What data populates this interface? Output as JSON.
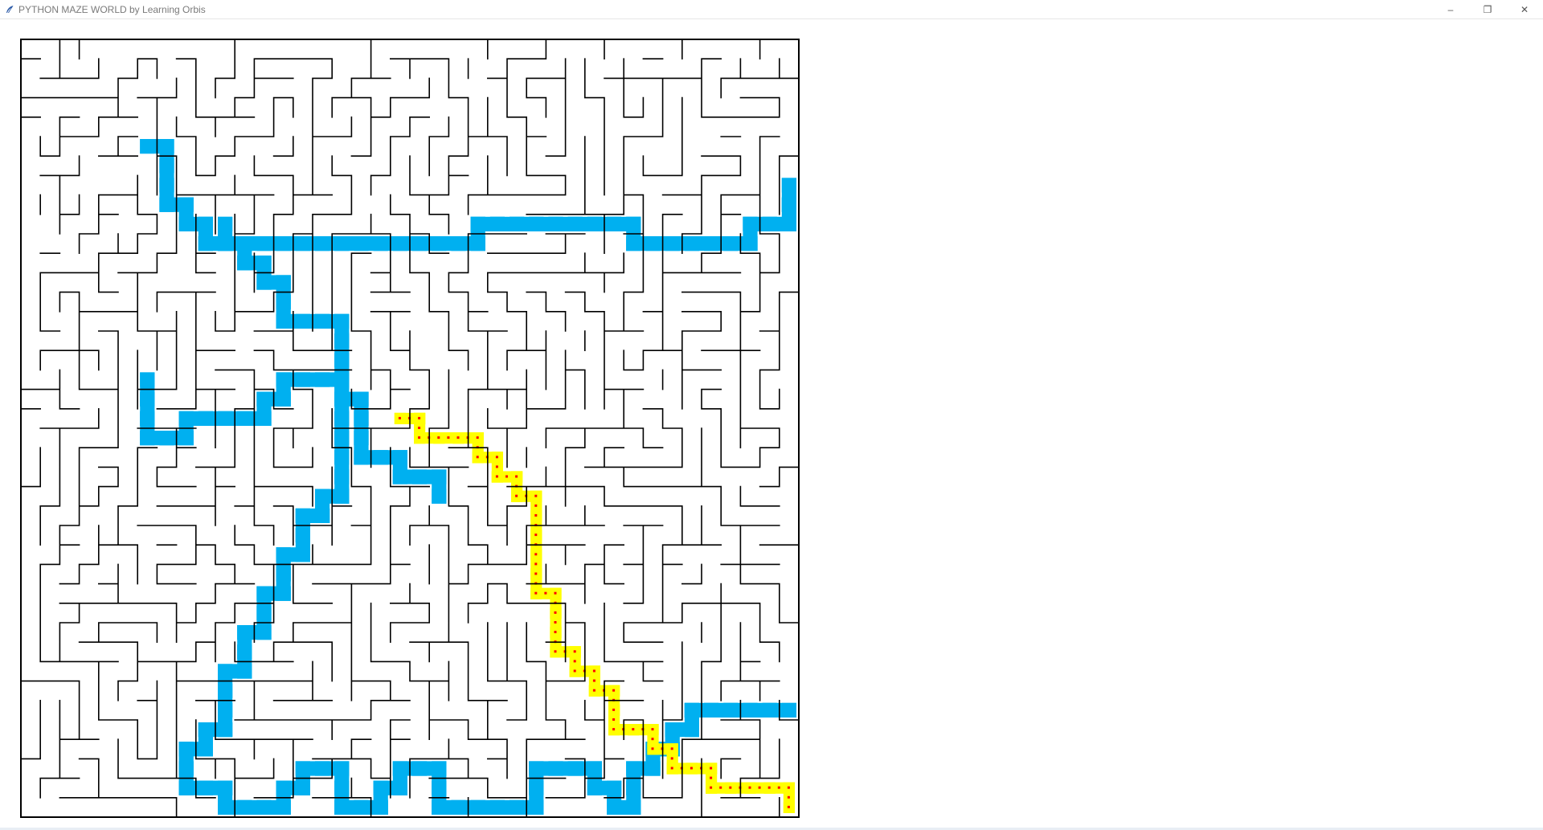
{
  "window": {
    "title": "PYTHON MAZE WORLD by Learning Orbis",
    "icon": "feather-icon",
    "controls": {
      "minimize": "–",
      "maximize": "❐",
      "close": "✕"
    }
  },
  "maze": {
    "rows": 40,
    "cols": 40,
    "wall_color": "#000000",
    "background_color": "#ffffff",
    "explored_color": "#00b0f0",
    "solution_color": "#ffff00",
    "solution_marker_color": "#ff0000",
    "seed": 7,
    "explored_path": [
      [
        6,
        17
      ],
      [
        6,
        18
      ],
      [
        6,
        19
      ],
      [
        6,
        20
      ],
      [
        7,
        20
      ],
      [
        8,
        20
      ],
      [
        8,
        19
      ],
      [
        9,
        19
      ],
      [
        10,
        19
      ],
      [
        11,
        19
      ],
      [
        12,
        19
      ],
      [
        12,
        18
      ],
      [
        13,
        18
      ],
      [
        13,
        17
      ],
      [
        14,
        17
      ],
      [
        15,
        17
      ],
      [
        16,
        17
      ],
      [
        16,
        18
      ],
      [
        17,
        18
      ],
      [
        17,
        19
      ],
      [
        17,
        20
      ],
      [
        17,
        21
      ],
      [
        18,
        21
      ],
      [
        19,
        21
      ],
      [
        19,
        22
      ],
      [
        20,
        22
      ],
      [
        21,
        22
      ],
      [
        21,
        23
      ],
      [
        10,
        9
      ],
      [
        10,
        10
      ],
      [
        11,
        10
      ],
      [
        12,
        10
      ],
      [
        13,
        10
      ],
      [
        14,
        10
      ],
      [
        15,
        10
      ],
      [
        16,
        10
      ],
      [
        17,
        10
      ],
      [
        18,
        10
      ],
      [
        19,
        10
      ],
      [
        20,
        10
      ],
      [
        21,
        10
      ],
      [
        22,
        10
      ],
      [
        23,
        10
      ],
      [
        23,
        9
      ],
      [
        24,
        9
      ],
      [
        25,
        9
      ],
      [
        26,
        9
      ],
      [
        27,
        9
      ],
      [
        28,
        9
      ],
      [
        29,
        9
      ],
      [
        30,
        9
      ],
      [
        31,
        9
      ],
      [
        31,
        10
      ],
      [
        32,
        10
      ],
      [
        33,
        10
      ],
      [
        34,
        10
      ],
      [
        35,
        10
      ],
      [
        36,
        10
      ],
      [
        37,
        10
      ],
      [
        37,
        9
      ],
      [
        38,
        9
      ],
      [
        39,
        9
      ],
      [
        39,
        8
      ],
      [
        39,
        7
      ],
      [
        6,
        5
      ],
      [
        7,
        5
      ],
      [
        7,
        6
      ],
      [
        7,
        7
      ],
      [
        7,
        8
      ],
      [
        8,
        8
      ],
      [
        8,
        9
      ],
      [
        9,
        9
      ],
      [
        9,
        10
      ],
      [
        10,
        10
      ],
      [
        11,
        10
      ],
      [
        11,
        11
      ],
      [
        12,
        11
      ],
      [
        12,
        12
      ],
      [
        13,
        12
      ],
      [
        13,
        13
      ],
      [
        13,
        14
      ],
      [
        14,
        14
      ],
      [
        15,
        14
      ],
      [
        16,
        14
      ],
      [
        16,
        15
      ],
      [
        16,
        16
      ],
      [
        16,
        17
      ],
      [
        16,
        18
      ],
      [
        16,
        19
      ],
      [
        16,
        20
      ],
      [
        16,
        21
      ],
      [
        16,
        22
      ],
      [
        16,
        23
      ],
      [
        15,
        23
      ],
      [
        15,
        24
      ],
      [
        14,
        24
      ],
      [
        14,
        25
      ],
      [
        14,
        26
      ],
      [
        13,
        26
      ],
      [
        13,
        27
      ],
      [
        13,
        28
      ],
      [
        12,
        28
      ],
      [
        12,
        29
      ],
      [
        12,
        30
      ],
      [
        11,
        30
      ],
      [
        11,
        31
      ],
      [
        11,
        32
      ],
      [
        10,
        32
      ],
      [
        10,
        33
      ],
      [
        10,
        34
      ],
      [
        10,
        35
      ],
      [
        9,
        35
      ],
      [
        9,
        36
      ],
      [
        8,
        36
      ],
      [
        8,
        37
      ],
      [
        8,
        38
      ],
      [
        9,
        38
      ],
      [
        10,
        38
      ],
      [
        10,
        39
      ],
      [
        11,
        39
      ],
      [
        12,
        39
      ],
      [
        13,
        39
      ],
      [
        13,
        38
      ],
      [
        14,
        38
      ],
      [
        14,
        37
      ],
      [
        15,
        37
      ],
      [
        16,
        37
      ],
      [
        16,
        38
      ],
      [
        16,
        39
      ],
      [
        17,
        39
      ],
      [
        18,
        39
      ],
      [
        18,
        38
      ],
      [
        19,
        38
      ],
      [
        19,
        37
      ],
      [
        20,
        37
      ],
      [
        21,
        37
      ],
      [
        21,
        38
      ],
      [
        21,
        39
      ],
      [
        22,
        39
      ],
      [
        23,
        39
      ],
      [
        24,
        39
      ],
      [
        25,
        39
      ],
      [
        26,
        39
      ],
      [
        26,
        38
      ],
      [
        26,
        37
      ],
      [
        27,
        37
      ],
      [
        28,
        37
      ],
      [
        29,
        37
      ],
      [
        29,
        38
      ],
      [
        30,
        38
      ],
      [
        30,
        39
      ],
      [
        31,
        39
      ],
      [
        31,
        38
      ],
      [
        31,
        37
      ],
      [
        32,
        37
      ],
      [
        32,
        36
      ],
      [
        33,
        36
      ],
      [
        33,
        35
      ],
      [
        34,
        35
      ],
      [
        34,
        34
      ],
      [
        35,
        34
      ],
      [
        36,
        34
      ],
      [
        37,
        34
      ],
      [
        38,
        34
      ],
      [
        39,
        34
      ]
    ],
    "solution_path": [
      [
        19,
        19
      ],
      [
        20,
        19
      ],
      [
        20,
        20
      ],
      [
        21,
        20
      ],
      [
        22,
        20
      ],
      [
        23,
        20
      ],
      [
        23,
        21
      ],
      [
        24,
        21
      ],
      [
        24,
        22
      ],
      [
        25,
        22
      ],
      [
        25,
        23
      ],
      [
        26,
        23
      ],
      [
        26,
        24
      ],
      [
        26,
        25
      ],
      [
        26,
        26
      ],
      [
        26,
        27
      ],
      [
        26,
        28
      ],
      [
        27,
        28
      ],
      [
        27,
        29
      ],
      [
        27,
        30
      ],
      [
        27,
        31
      ],
      [
        28,
        31
      ],
      [
        28,
        32
      ],
      [
        29,
        32
      ],
      [
        29,
        33
      ],
      [
        30,
        33
      ],
      [
        30,
        34
      ],
      [
        30,
        35
      ],
      [
        31,
        35
      ],
      [
        32,
        35
      ],
      [
        32,
        36
      ],
      [
        33,
        36
      ],
      [
        33,
        37
      ],
      [
        34,
        37
      ],
      [
        35,
        37
      ],
      [
        35,
        38
      ],
      [
        36,
        38
      ],
      [
        37,
        38
      ],
      [
        38,
        38
      ],
      [
        39,
        38
      ],
      [
        39,
        39
      ]
    ]
  }
}
